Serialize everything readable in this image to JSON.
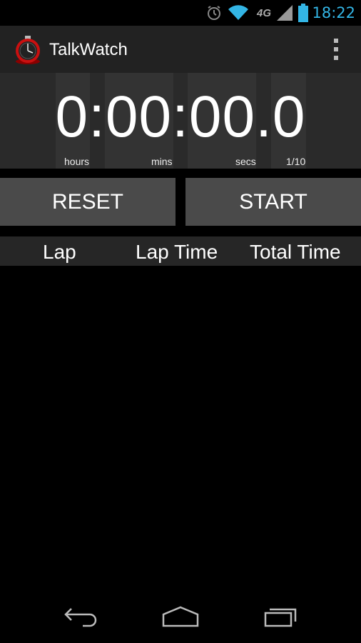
{
  "status_bar": {
    "time": "18:22",
    "network": "4G",
    "icons": [
      "alarm-icon",
      "wifi-icon",
      "network-4g-icon",
      "signal-icon",
      "battery-icon"
    ]
  },
  "action_bar": {
    "title": "TalkWatch",
    "icon": "stopwatch-icon",
    "menu_icon": "overflow-menu-icon"
  },
  "timer": {
    "display": "0:00:00.0",
    "units": {
      "hours": "hours",
      "mins": "mins",
      "secs": "secs",
      "tenths": "1/10"
    }
  },
  "controls": {
    "reset_label": "RESET",
    "start_label": "START"
  },
  "lap_table": {
    "columns": [
      "Lap",
      "Lap Time",
      "Total Time"
    ],
    "rows": []
  },
  "nav_bar": {
    "icons": [
      "back-icon",
      "home-icon",
      "recent-apps-icon"
    ]
  },
  "colors": {
    "accent": "#33b5e5",
    "action_bar": "#222222",
    "button": "#4a4a4a",
    "panel": "#2a2a2a"
  }
}
